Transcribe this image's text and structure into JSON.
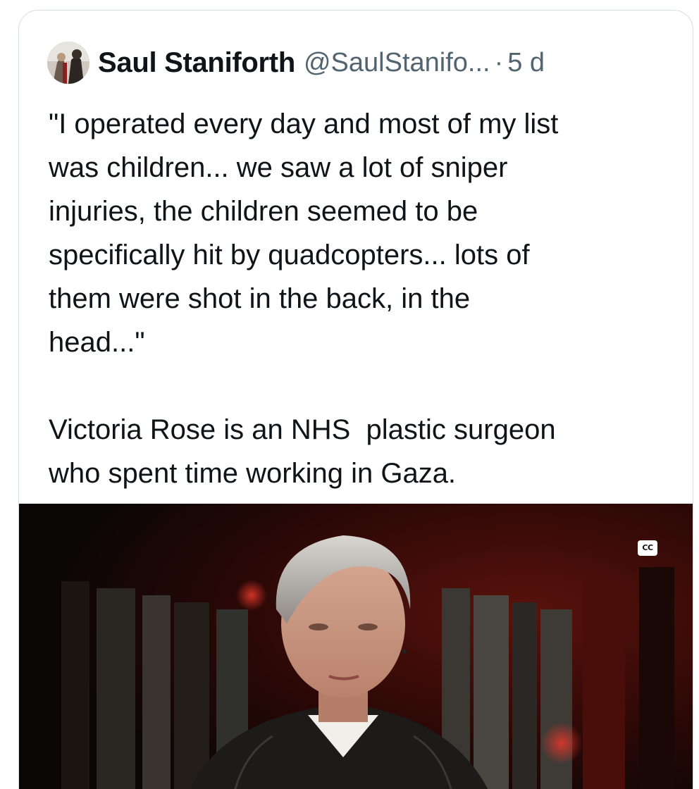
{
  "tweet": {
    "author": {
      "name": "Saul Staniforth",
      "handle": "@SaulStanifo...",
      "avatar_icon": "avatar-photo"
    },
    "separator": "·",
    "time": "5 d",
    "text": "\"I operated every day and most of my list\nwas children... we saw a lot of sniper\ninjuries, the children seemed to be\nspecifically hit by quadcopters... lots of\nthem were shot in the back, in the\nhead...\"\n\nVictoria Rose is an NHS  plastic surgeon\nwho spent time working in Gaza."
  },
  "media": {
    "type": "video",
    "cc_label": "CC"
  }
}
